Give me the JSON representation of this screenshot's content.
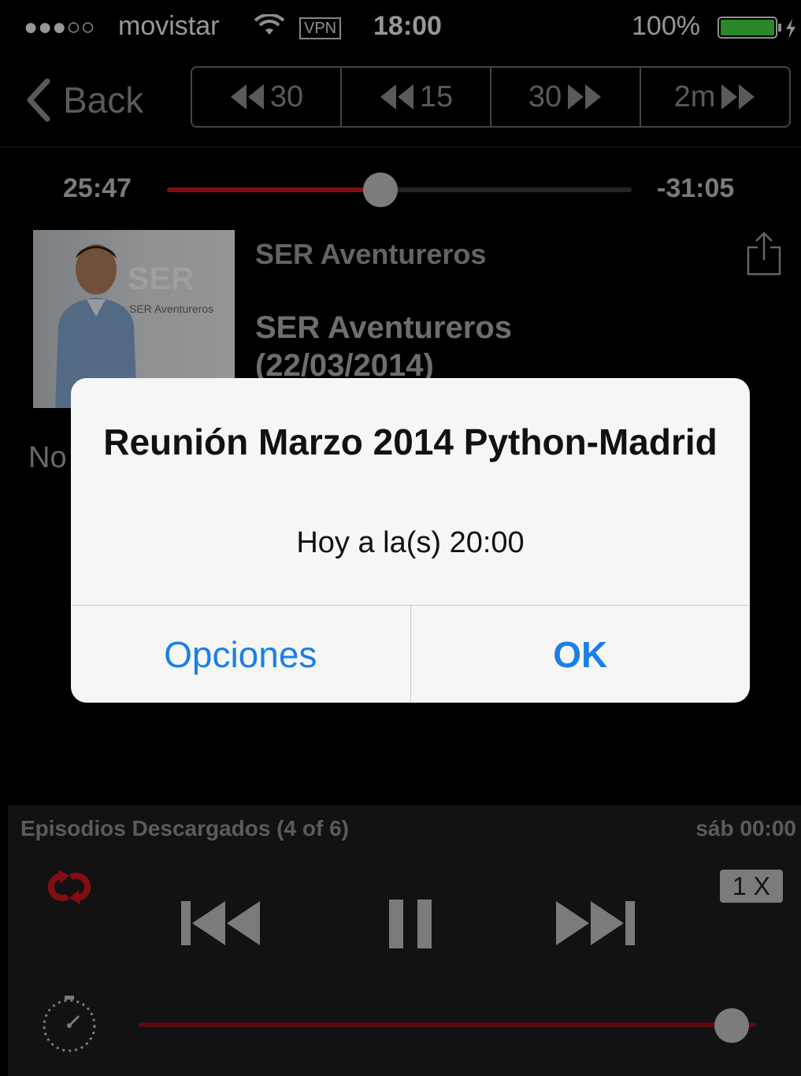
{
  "status_bar": {
    "signal": "●●●○○",
    "carrier": "movistar",
    "vpn": "VPN",
    "time": "18:00",
    "battery": "100%"
  },
  "nav": {
    "back_label": "Back",
    "skip_buttons": [
      {
        "label": "30",
        "direction": "rewind"
      },
      {
        "label": "15",
        "direction": "rewind"
      },
      {
        "label": "30",
        "direction": "forward"
      },
      {
        "label": "2m",
        "direction": "forward"
      }
    ]
  },
  "playback": {
    "elapsed": "25:47",
    "remaining": "-31:05",
    "progress": 0.46
  },
  "episode": {
    "artwork_logo": "SER",
    "artwork_subtitle": "SER Aventureros",
    "podcast_name": "SER Aventureros",
    "title": "SER Aventureros (22/03/2014)",
    "notes_prefix": "No"
  },
  "alert": {
    "title": "Reunión Marzo 2014 Python-Madrid",
    "message": "Hoy a la(s) 20:00",
    "buttons": {
      "options": "Opciones",
      "ok": "OK"
    }
  },
  "player": {
    "playlist": "Episodios Descargados (4 of 6)",
    "date": "sáb 00:00",
    "speed": "1 X",
    "volume": 0.96
  },
  "colors": {
    "accent_red": "#c8161d",
    "alert_button_blue": "#1a7fe8"
  }
}
